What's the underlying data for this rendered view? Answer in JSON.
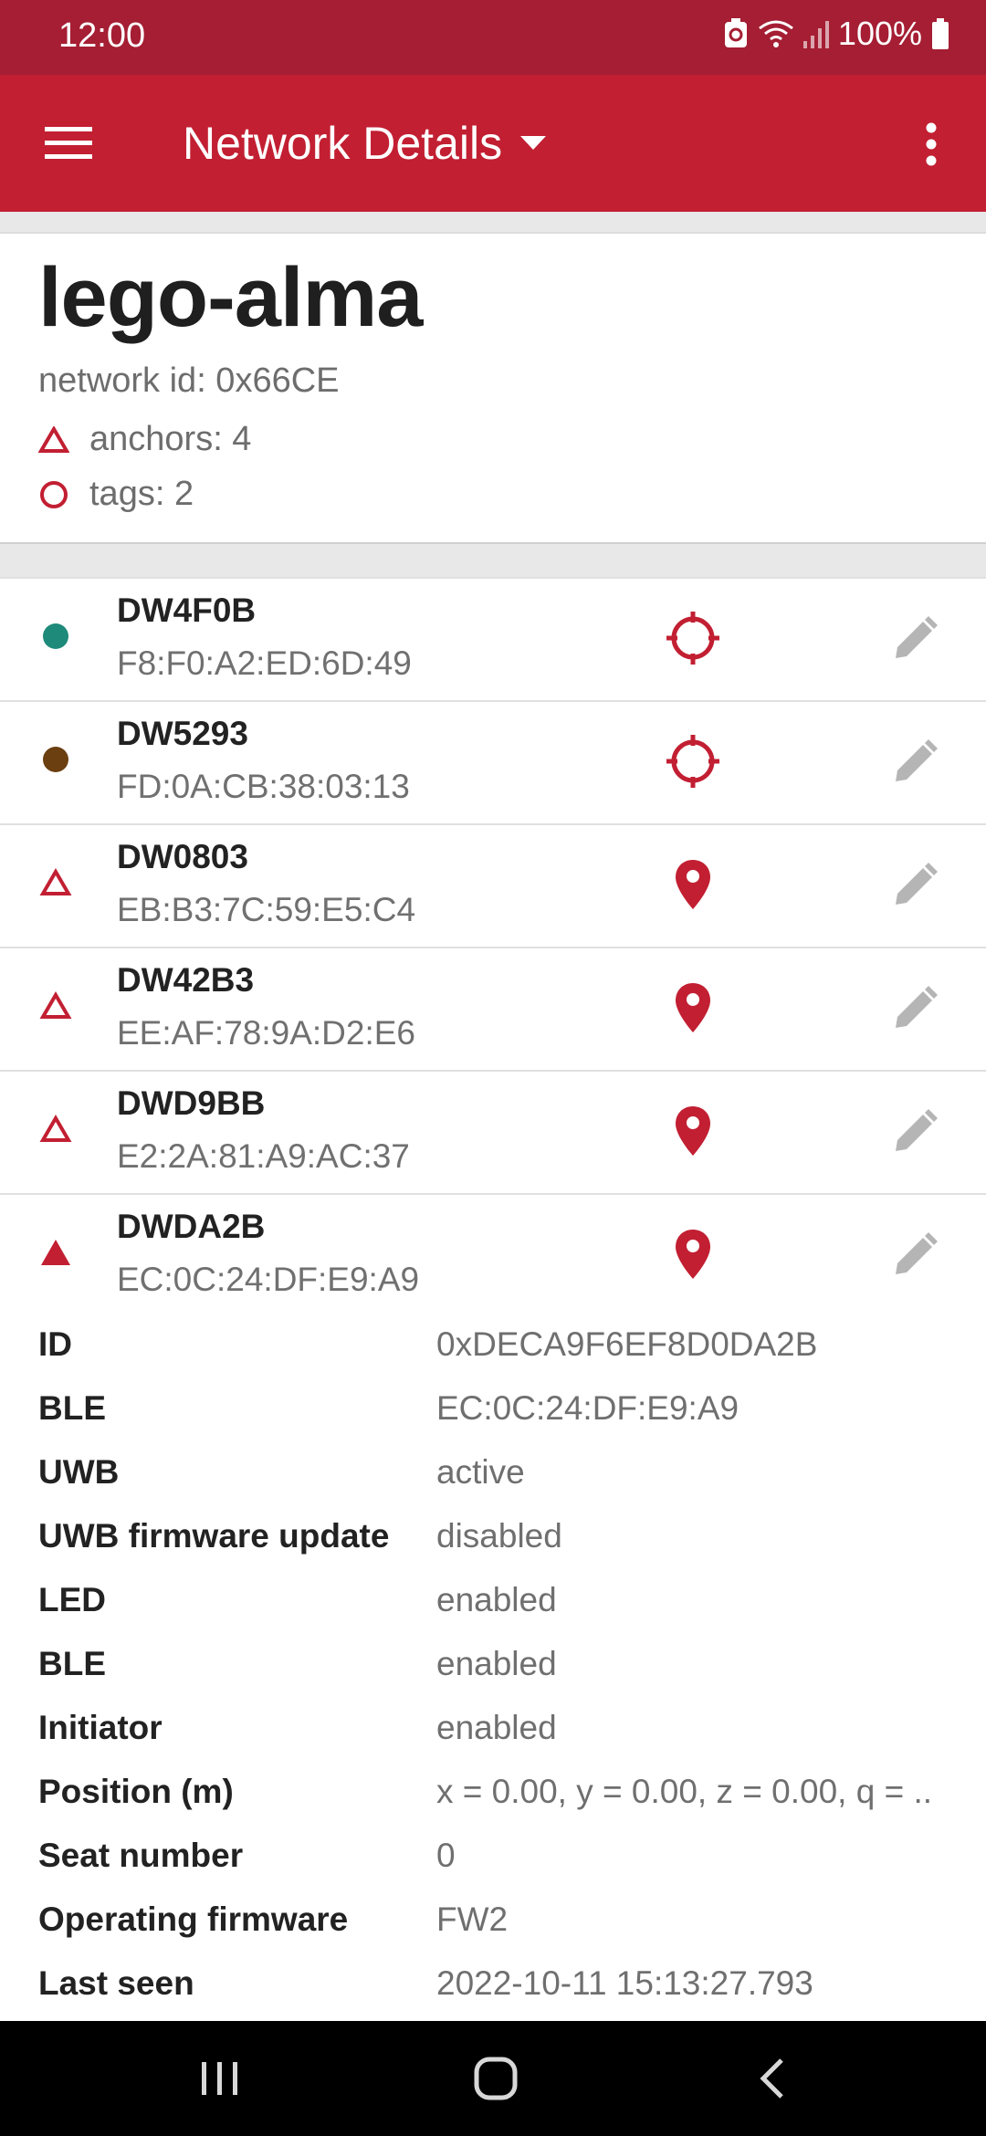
{
  "status_bar": {
    "time": "12:00",
    "battery": "100%"
  },
  "app_bar": {
    "title": "Network Details"
  },
  "network": {
    "name": "lego-alma",
    "id_text": "network id: 0x66CE",
    "anchors_text": "anchors: 4",
    "tags_text": "tags: 2"
  },
  "devices": [
    {
      "name": "DW4F0B",
      "mac": "F8:F0:A2:ED:6D:49",
      "kind": "tag",
      "color": "#1e8a7a",
      "action_icon": "crosshair-icon"
    },
    {
      "name": "DW5293",
      "mac": "FD:0A:CB:38:03:13",
      "kind": "tag",
      "color": "#6b3f10",
      "action_icon": "crosshair-icon"
    },
    {
      "name": "DW0803",
      "mac": "EB:B3:7C:59:E5:C4",
      "kind": "anchor",
      "action_icon": "location-pin-icon"
    },
    {
      "name": "DW42B3",
      "mac": "EE:AF:78:9A:D2:E6",
      "kind": "anchor",
      "action_icon": "location-pin-icon"
    },
    {
      "name": "DWD9BB",
      "mac": "E2:2A:81:A9:AC:37",
      "kind": "anchor",
      "action_icon": "location-pin-icon"
    },
    {
      "name": "DWDA2B",
      "mac": "EC:0C:24:DF:E9:A9",
      "kind": "anchor-initiator",
      "action_icon": "location-pin-icon"
    }
  ],
  "details": [
    {
      "label": "ID",
      "value": "0xDECA9F6EF8D0DA2B"
    },
    {
      "label": "BLE",
      "value": "EC:0C:24:DF:E9:A9"
    },
    {
      "label": "UWB",
      "value": "active"
    },
    {
      "label": "UWB firmware update",
      "value": "disabled"
    },
    {
      "label": "LED",
      "value": "enabled"
    },
    {
      "label": "BLE",
      "value": "enabled"
    },
    {
      "label": "Initiator",
      "value": "enabled"
    },
    {
      "label": "Position (m)",
      "value": "x = 0.00, y = 0.00, z = 0.00, q = .."
    },
    {
      "label": "Seat number",
      "value": "0"
    },
    {
      "label": "Operating firmware",
      "value": "FW2"
    },
    {
      "label": "Last seen",
      "value": "2022-10-11 15:13:27.793"
    }
  ],
  "colors": {
    "status_bar": "#a51e33",
    "app_bar": "#c21f32",
    "accent": "#c21f32"
  }
}
